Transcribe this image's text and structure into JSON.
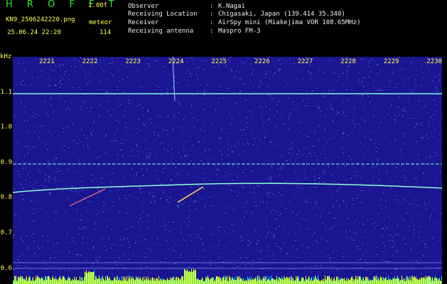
{
  "header": {
    "brand": "H R O F F T",
    "version": "1.00f",
    "filename": "KN9_2506242220.png",
    "mode": "meteor",
    "datetime": "25.06.24 22:20",
    "count": "114"
  },
  "meta": [
    {
      "label": "Observer",
      "value": "K.Nagai"
    },
    {
      "label": "Receiving Location",
      "value": "Chigasaki, Japan (139.414 35.340)"
    },
    {
      "label": "Receiver",
      "value": "AirSpy mini (Miakejima VOR 108.65MHz)"
    },
    {
      "label": "Receiving antenna",
      "value": "Maspro FM-3"
    }
  ],
  "y_unit": "kHz",
  "y_ticks": [
    "1.1",
    "1.0",
    "0.9",
    "0.8",
    "0.7",
    "0.6"
  ],
  "x_ticks": [
    "2221",
    "2222",
    "2223",
    "2224",
    "2225",
    "2226",
    "2227",
    "2228",
    "2229",
    "2230"
  ],
  "colors": {
    "background": "#1a1590",
    "trace": "#7dffe0",
    "label": "#ffff55",
    "bars": "#ffff00"
  }
}
